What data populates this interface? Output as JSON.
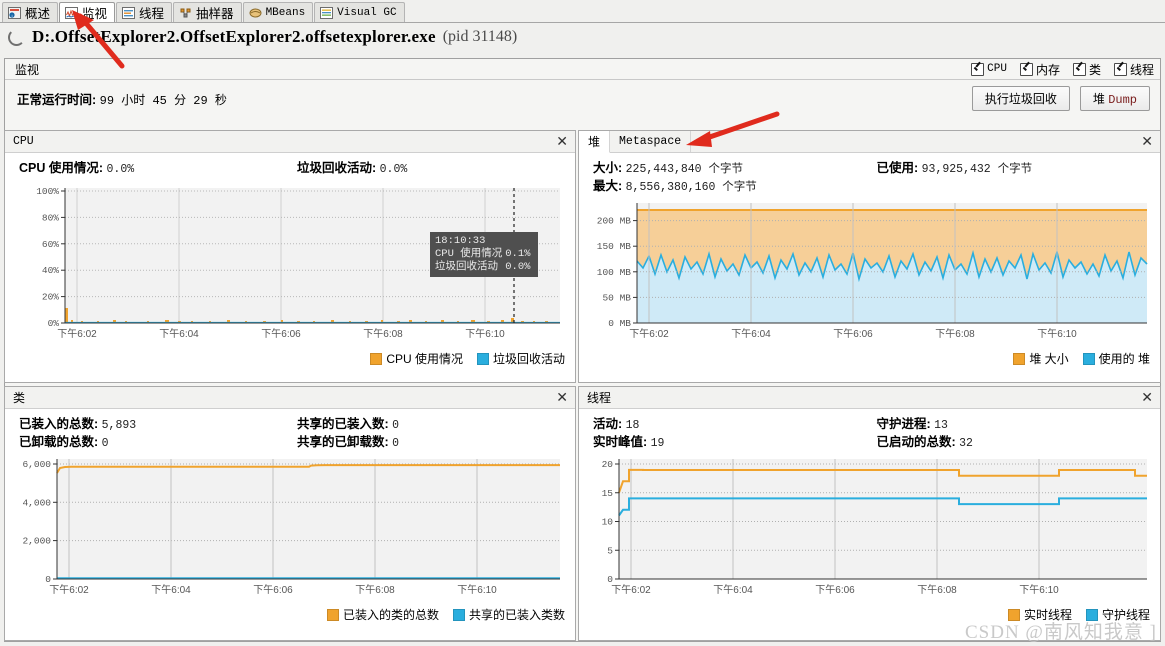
{
  "tabs": [
    {
      "label": "概述",
      "icon": "overview-icon",
      "active": false
    },
    {
      "label": "监视",
      "icon": "monitor-icon",
      "active": true
    },
    {
      "label": "线程",
      "icon": "threads-icon",
      "active": false
    },
    {
      "label": "抽样器",
      "icon": "sampler-icon",
      "active": false
    },
    {
      "label": "MBeans",
      "icon": "mbeans-icon",
      "active": false
    },
    {
      "label": "Visual GC",
      "icon": "visualgc-icon",
      "active": false
    }
  ],
  "header": {
    "process": "D:.OffsetExplorer2.OffsetExplorer2.offsetexplorer.exe",
    "pid": "(pid 31148)",
    "spinner_icon": "loading-spinner-icon"
  },
  "monitor": {
    "panel_label": "监视",
    "checkboxes": [
      {
        "label": "CPU",
        "checked": true
      },
      {
        "label": "内存",
        "checked": true
      },
      {
        "label": "类",
        "checked": true
      },
      {
        "label": "线程",
        "checked": true
      }
    ],
    "uptime_label": "正常运行时间:",
    "uptime_value": "99 小时 45 分 29 秒",
    "gc_button": "执行垃圾回收",
    "heapdump_button_prefix": "堆",
    "heapdump_button_suffix": "Dump"
  },
  "cpu_card": {
    "title": "CPU",
    "close_icon": "close-icon",
    "stats": [
      {
        "label": "CPU 使用情况:",
        "value": "0.0%"
      },
      {
        "label": "垃圾回收活动:",
        "value": "0.0%"
      }
    ],
    "tooltip": {
      "time": "18:10:33",
      "rows": [
        {
          "label": "CPU 使用情况",
          "value": "0.1%"
        },
        {
          "label": "垃圾回收活动",
          "value": "0.0%"
        }
      ]
    },
    "legend": [
      {
        "label": "CPU 使用情况",
        "color": "#f0a32d"
      },
      {
        "label": "垃圾回收活动",
        "color": "#2aaede"
      }
    ]
  },
  "heap_card": {
    "tabs": [
      {
        "label": "堆",
        "selected": true
      },
      {
        "label": "Metaspace",
        "selected": false
      }
    ],
    "close_icon": "close-icon",
    "stats": [
      {
        "label": "大小:",
        "value": "225,443,840 个字节"
      },
      {
        "label": "已使用:",
        "value": "93,925,432 个字节"
      },
      {
        "label": "最大:",
        "value": "8,556,380,160 个字节"
      }
    ],
    "legend": [
      {
        "label": "堆 大小",
        "color": "#f0a32d"
      },
      {
        "label": "使用的 堆",
        "color": "#2aaede"
      }
    ]
  },
  "classes_card": {
    "title": "类",
    "close_icon": "close-icon",
    "stats": [
      {
        "label": "已装入的总数:",
        "value": "5,893"
      },
      {
        "label": "共享的已装入数:",
        "value": "0"
      },
      {
        "label": "已卸载的总数:",
        "value": "0"
      },
      {
        "label": "共享的已卸载数:",
        "value": "0"
      }
    ],
    "legend": [
      {
        "label": "已装入的类的总数",
        "color": "#f0a32d"
      },
      {
        "label": "共享的已装入类数",
        "color": "#2aaede"
      }
    ]
  },
  "threads_card": {
    "title": "线程",
    "close_icon": "close-icon",
    "stats": [
      {
        "label": "活动:",
        "value": "18"
      },
      {
        "label": "守护进程:",
        "value": "13"
      },
      {
        "label": "实时峰值:",
        "value": "19"
      },
      {
        "label": "已启动的总数:",
        "value": "32"
      }
    ],
    "legend": [
      {
        "label": "实时线程",
        "color": "#f0a32d"
      },
      {
        "label": "守护线程",
        "color": "#2aaede"
      }
    ]
  },
  "watermark": "CSDN @南风知我意 ]",
  "chart_data": [
    {
      "id": "cpu",
      "type": "area",
      "title": "CPU",
      "xlabel": "",
      "ylabel": "",
      "ylim": [
        0,
        100
      ],
      "yticks": [
        "0%",
        "20%",
        "40%",
        "60%",
        "80%",
        "100%"
      ],
      "xticks": [
        "下午6:02",
        "下午6:04",
        "下午6:06",
        "下午6:08",
        "下午6:10"
      ],
      "grid": true,
      "series": [
        {
          "name": "CPU 使用情况",
          "color": "#f0a32d",
          "values": [
            3.5,
            0.4,
            0.2,
            0.1,
            0.1,
            0.3,
            0.2,
            0.1,
            0.1,
            0.4,
            0.2,
            0.1,
            0.1,
            0.2,
            0.5,
            0.1,
            0.2,
            0.1,
            0.1,
            0.1,
            0.3,
            0.2,
            0.1,
            0.1,
            0.1,
            0.2,
            0.4,
            0.2,
            0.1,
            0.1,
            0.1,
            0.1,
            0.3,
            0.2,
            0.1,
            0.1,
            0.2,
            0.1,
            0.1,
            0.5,
            0.3,
            0.2,
            0.1,
            0.1,
            0.2,
            0.1,
            0.1,
            0.1,
            0.3,
            0.2,
            0.1,
            0.2,
            0.4,
            0.2,
            0.1,
            0.1,
            0.2,
            0.1,
            0.1,
            0.2,
            0.3,
            0.1,
            0.1,
            0.2,
            0.6,
            0.4,
            0.2,
            0.1,
            0.1,
            0.2,
            0.1,
            0.3,
            0.2,
            0.1,
            0.1,
            0.1,
            0.4,
            0.2,
            0.8,
            0.3,
            0.2,
            0.1,
            0.1,
            0.2,
            0.1,
            0.1,
            0.2,
            0.3,
            0.1,
            0.1
          ]
        },
        {
          "name": "垃圾回收活动",
          "color": "#2aaede",
          "values": [
            0,
            0,
            0,
            0,
            0,
            0,
            0,
            0,
            0,
            0,
            0,
            0,
            0,
            0,
            0,
            0,
            0,
            0,
            0,
            0,
            0,
            0,
            0,
            0,
            0,
            0,
            0,
            0,
            0,
            0,
            0,
            0,
            0,
            0,
            0,
            0,
            0,
            0,
            0,
            0,
            0,
            0,
            0,
            0,
            0,
            0,
            0,
            0,
            0,
            0,
            0,
            0,
            0,
            0,
            0,
            0,
            0,
            0,
            0,
            0,
            0,
            0,
            0,
            0,
            0,
            0,
            0,
            0,
            0,
            0,
            0,
            0,
            0,
            0,
            0,
            0,
            0,
            0,
            0,
            0,
            0,
            0,
            0,
            0,
            0,
            0,
            0,
            0,
            0,
            0
          ]
        }
      ]
    },
    {
      "id": "heap",
      "type": "area",
      "title": "堆",
      "ylim": [
        0,
        215
      ],
      "yticks": [
        "0 MB",
        "50 MB",
        "100 MB",
        "150 MB",
        "200 MB"
      ],
      "xticks": [
        "下午6:02",
        "下午6:04",
        "下午6:06",
        "下午6:08",
        "下午6:10"
      ],
      "grid": true,
      "series": [
        {
          "name": "堆 大小",
          "color": "#f0a32d",
          "unit": "MB",
          "values": [
            215,
            215,
            215,
            215,
            215,
            215,
            215,
            215,
            215,
            215,
            215,
            215,
            215,
            215,
            215,
            215,
            215,
            215,
            215,
            215,
            215,
            215,
            215,
            215,
            215,
            215,
            215,
            215,
            215,
            215,
            215,
            215,
            215,
            215,
            215,
            215,
            215,
            215,
            215,
            215,
            215,
            215,
            215,
            215,
            215,
            215,
            215,
            215,
            215,
            215,
            215,
            215,
            215,
            215,
            215,
            215,
            215,
            215,
            215,
            215,
            215,
            215,
            215,
            215,
            215,
            215,
            215,
            215,
            215,
            215,
            215,
            215,
            215,
            215,
            215,
            215,
            215,
            215,
            215,
            215,
            215,
            215,
            215,
            215,
            215,
            215,
            215,
            215,
            215,
            215
          ]
        },
        {
          "name": "使用的 堆",
          "color": "#2aaede",
          "unit": "MB",
          "values": [
            88,
            80,
            92,
            70,
            95,
            74,
            88,
            66,
            93,
            78,
            85,
            72,
            96,
            68,
            90,
            76,
            84,
            70,
            94,
            80,
            87,
            73,
            92,
            67,
            89,
            79,
            95,
            71,
            86,
            75,
            91,
            69,
            93,
            77,
            84,
            72,
            96,
            66,
            90,
            80,
            85,
            74,
            92,
            68,
            88,
            78,
            94,
            70,
            86,
            76,
            91,
            67,
            93,
            79,
            84,
            73,
            95,
            69,
            89,
            75,
            90,
            71,
            87,
            80,
            92,
            66,
            94,
            77,
            85,
            72,
            96,
            68,
            88,
            79,
            91,
            74,
            84,
            70,
            93,
            76,
            86,
            67,
            95,
            71,
            90,
            78,
            87,
            73,
            92,
            85
          ]
        }
      ]
    },
    {
      "id": "classes",
      "type": "line",
      "title": "类",
      "ylim": [
        0,
        6400
      ],
      "yticks": [
        "0",
        "2,000",
        "4,000",
        "6,000"
      ],
      "xticks": [
        "下午6:02",
        "下午6:04",
        "下午6:06",
        "下午6:08",
        "下午6:10"
      ],
      "grid": true,
      "series": [
        {
          "name": "已装入的类的总数",
          "color": "#f0a32d",
          "values": [
            5700,
            5810,
            5830,
            5835,
            5838,
            5840,
            5840,
            5840,
            5840,
            5840,
            5840,
            5840,
            5840,
            5840,
            5840,
            5840,
            5840,
            5840,
            5840,
            5840,
            5840,
            5840,
            5840,
            5840,
            5840,
            5840,
            5840,
            5840,
            5840,
            5840,
            5840,
            5840,
            5840,
            5840,
            5840,
            5840,
            5840,
            5840,
            5840,
            5840,
            5840,
            5840,
            5840,
            5840,
            5840,
            5840,
            5840,
            5840,
            5840,
            5840,
            5840,
            5880,
            5885,
            5890,
            5890,
            5890,
            5890,
            5890,
            5890,
            5890,
            5893,
            5893,
            5893,
            5893,
            5893,
            5893,
            5893,
            5893,
            5893,
            5893,
            5893,
            5893,
            5893,
            5893,
            5893,
            5893,
            5893,
            5893,
            5893,
            5893,
            5893,
            5893,
            5893,
            5893,
            5893,
            5893,
            5893,
            5893,
            5893,
            5893
          ]
        },
        {
          "name": "共享的已装入类数",
          "color": "#2aaede",
          "values": [
            0,
            0,
            0,
            0,
            0,
            0,
            0,
            0,
            0,
            0,
            0,
            0,
            0,
            0,
            0,
            0,
            0,
            0,
            0,
            0,
            0,
            0,
            0,
            0,
            0,
            0,
            0,
            0,
            0,
            0,
            0,
            0,
            0,
            0,
            0,
            0,
            0,
            0,
            0,
            0,
            0,
            0,
            0,
            0,
            0,
            0,
            0,
            0,
            0,
            0,
            0,
            0,
            0,
            0,
            0,
            0,
            0,
            0,
            0,
            0,
            0,
            0,
            0,
            0,
            0,
            0,
            0,
            0,
            0,
            0,
            0,
            0,
            0,
            0,
            0,
            0,
            0,
            0,
            0,
            0,
            0,
            0,
            0,
            0,
            0,
            0,
            0,
            0,
            0,
            0
          ]
        }
      ]
    },
    {
      "id": "threads",
      "type": "line",
      "title": "线程",
      "ylim": [
        0,
        21
      ],
      "yticks": [
        "0",
        "5",
        "10",
        "15",
        "20"
      ],
      "xticks": [
        "下午6:02",
        "下午6:04",
        "下午6:06",
        "下午6:08",
        "下午6:10"
      ],
      "grid": true,
      "series": [
        {
          "name": "实时线程",
          "color": "#f0a32d",
          "values": [
            15,
            17,
            17,
            19,
            19,
            19,
            19,
            19,
            19,
            19,
            19,
            19,
            19,
            19,
            19,
            19,
            19,
            19,
            19,
            19,
            19,
            19,
            19,
            19,
            19,
            19,
            19,
            19,
            19,
            19,
            19,
            19,
            19,
            19,
            19,
            19,
            19,
            19,
            19,
            19,
            19,
            19,
            19,
            19,
            19,
            19,
            19,
            19,
            19,
            19,
            19,
            19,
            19,
            19,
            19,
            19,
            19,
            19,
            19,
            19,
            19,
            19,
            19,
            19,
            19,
            19,
            18,
            18,
            18,
            18,
            18,
            18,
            18,
            18,
            18,
            18,
            18,
            18,
            18,
            18,
            19,
            19,
            19,
            19,
            19,
            19,
            19,
            19,
            19,
            18
          ]
        },
        {
          "name": "守护线程",
          "color": "#2aaede",
          "values": [
            11,
            12,
            12,
            14,
            14,
            14,
            14,
            14,
            14,
            14,
            14,
            14,
            14,
            14,
            14,
            14,
            14,
            14,
            14,
            14,
            13,
            13,
            13,
            13,
            13,
            13,
            13,
            13,
            13,
            13,
            13,
            13,
            13,
            13,
            13,
            13,
            13,
            13,
            13,
            13,
            13,
            13,
            13,
            13,
            13,
            13,
            13,
            13,
            13,
            13,
            13,
            13,
            13,
            13,
            13,
            13,
            13,
            13,
            13,
            13,
            13,
            13,
            13,
            13,
            13,
            13,
            12,
            12,
            12,
            12,
            12,
            12,
            12,
            12,
            12,
            12,
            12,
            12,
            12,
            12,
            13,
            13,
            13,
            13,
            13,
            13,
            13,
            13,
            13,
            13
          ]
        }
      ]
    }
  ]
}
